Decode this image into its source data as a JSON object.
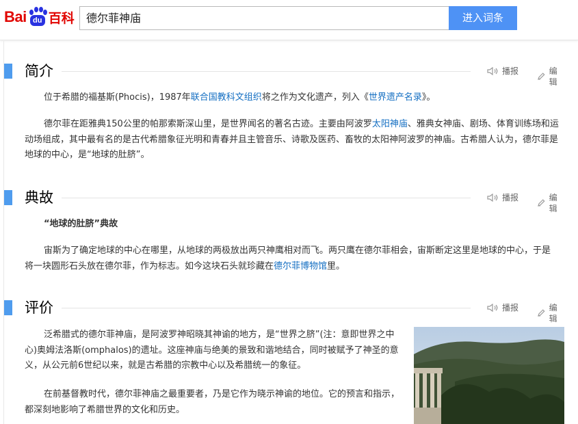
{
  "header": {
    "logo_bai": "Bai",
    "logo_du": "du",
    "logo_baike": "百科",
    "search_value": "德尔菲神庙",
    "search_button": "进入词条"
  },
  "tools": {
    "play": "播报",
    "edit": "编辑"
  },
  "sections": [
    {
      "title": "简介",
      "paragraphs": [
        {
          "p1_a": "位于希腊的福基斯(Phocis)，1987年",
          "p1_link1": "联合国教科文组织",
          "p1_b": "将之作为文化遗产，列入《",
          "p1_link2": "世界遗产名录",
          "p1_c": "》。"
        },
        {
          "p2_a": "德尔菲在距雅典150公里的帕那索斯深山里，是世界闻名的著名古迹。主要由阿波罗",
          "p2_link": "太阳神庙",
          "p2_b": "、雅典女神庙、剧场、体育训练场和运动场组成，其中最有名的是古代希腊象征光明和青春并且主管音乐、诗歌及医药、畜牧的太阳神阿波罗的神庙。古希腊人认为，德尔菲是地球的中心，是“地球的肚脐”。"
        }
      ]
    },
    {
      "title": "典故",
      "subtitle": "“地球的肚脐”典故",
      "paragraphs": [
        {
          "p1_a": "宙斯为了确定地球的中心在哪里，从地球的两极放出两只神鹰相对而飞。两只鹰在德尔菲相会，宙斯断定这里是地球的中心，于是将一块圆形石头放在德尔菲，作为标志。如今这块石头就珍藏在",
          "p1_link": "德尔菲博物馆",
          "p1_b": "里。"
        }
      ]
    },
    {
      "title": "评价",
      "paragraphs": [
        {
          "p1": "泛希腊式的德尔菲神庙，是阿波罗神昭晓其神谕的地方，是“世界之脐”(注：意即世界之中心)奥姆法洛斯(omphalos)的遗址。这座神庙与绝美的景致和谐地结合，同时被赋予了神圣的意义，从公元前6世纪以来，就是古希腊的宗教中心以及希腊统一的象征。"
        },
        {
          "p2": "在前基督教时代，德尔菲神庙之最重要者，乃是它作为晓示神谕的地位。它的预言和指示，都深刻地影响了希腊世界的文化和历史。"
        }
      ]
    }
  ],
  "colors": {
    "accent_bar": "#4f9cee",
    "link": "#136ec2",
    "search_button": "#4e92f5",
    "logo_red": "#e10602",
    "logo_blue": "#2932e1"
  }
}
